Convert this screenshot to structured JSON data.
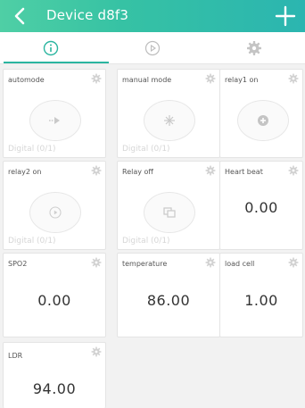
{
  "header": {
    "title": "Device d8f3"
  },
  "tabs": [
    "info",
    "play",
    "settings"
  ],
  "colors": {
    "accent": "#2bb5a0",
    "header_start": "#4fcfa5",
    "header_end": "#2bb5b0"
  },
  "tiles": {
    "automode": {
      "label": "automode",
      "sub": "Digital (0/1)",
      "icon": "arrow-right-icon"
    },
    "manual": {
      "label": "manual mode",
      "sub": "Digital (0/1)",
      "icon": "asterisk-icon"
    },
    "relay1": {
      "label": "relay1 on",
      "sub": "",
      "icon": "plus-circle-icon"
    },
    "relay2": {
      "label": "relay2 on",
      "sub": "Digital (0/1)",
      "icon": "play-circle-icon"
    },
    "relayoff": {
      "label": "Relay off",
      "sub": "Digital (0/1)",
      "icon": "copy-icon"
    },
    "heartbeat": {
      "label": "Heart beat",
      "value": "0.00"
    },
    "spo2": {
      "label": "SPO2",
      "value": "0.00"
    },
    "temperature": {
      "label": "temperature",
      "value": "86.00"
    },
    "loadcell": {
      "label": "load cell",
      "value": "1.00"
    },
    "ldr": {
      "label": "LDR",
      "value": "94.00"
    }
  }
}
